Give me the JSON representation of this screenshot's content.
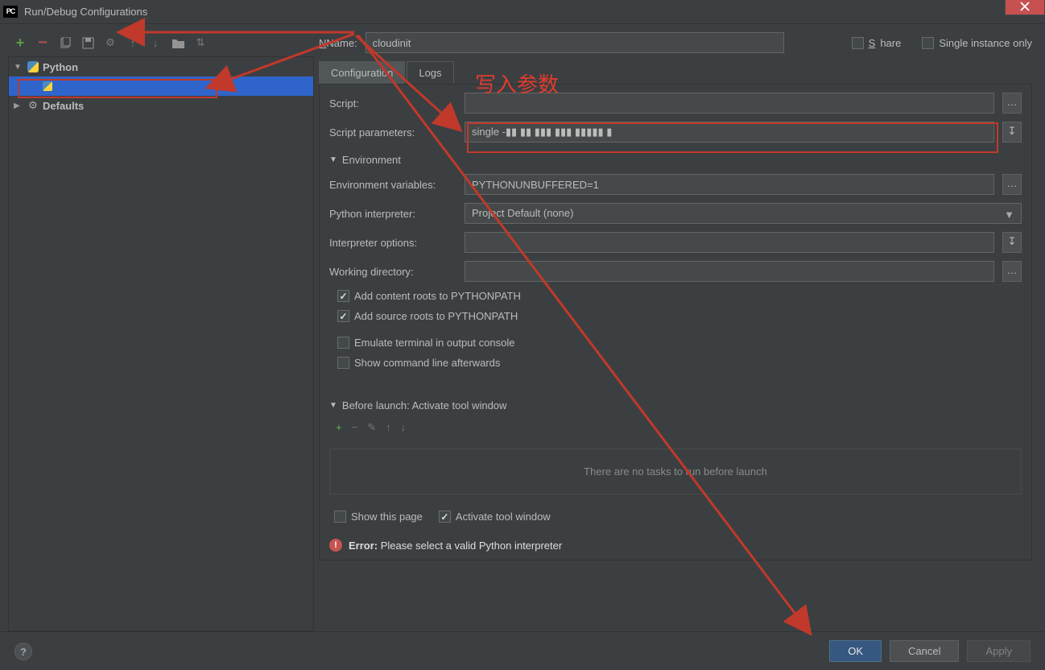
{
  "window": {
    "title": "Run/Debug Configurations"
  },
  "toolbar_icons": [
    "add",
    "remove",
    "copy",
    "save",
    "settings",
    "up",
    "down",
    "folder",
    "expand"
  ],
  "tree": {
    "python_label": "Python",
    "selected_item": "       ",
    "defaults_label": "Defaults"
  },
  "header": {
    "name_label": "Name:",
    "name_value": "cloudinit",
    "share_label": "Share",
    "single_instance_label": "Single instance only"
  },
  "tabs": {
    "configuration": "Configuration",
    "logs": "Logs"
  },
  "form": {
    "script_label": "Script:",
    "script_value": " ",
    "script_params_label": "Script parameters:",
    "script_params_value": "single -▮▮ ▮▮ ▮▮▮ ▮▮▮ ▮▮▮▮▮ ▮",
    "env_section": "Environment",
    "env_vars_label": "Environment variables:",
    "env_vars_value": "PYTHONUNBUFFERED=1",
    "interpreter_label": "Python interpreter:",
    "interpreter_value": "Project Default (none)",
    "interpreter_opts_label": "Interpreter options:",
    "interpreter_opts_value": "",
    "workdir_label": "Working directory:",
    "workdir_value": " ",
    "add_content_roots": "Add content roots to PYTHONPATH",
    "add_source_roots": "Add source roots to PYTHONPATH",
    "emulate_terminal": "Emulate terminal in output console",
    "show_cmdline": "Show command line afterwards",
    "before_launch_hdr": "Before launch: Activate tool window",
    "no_tasks": "There are no tasks to run before launch",
    "show_this_page": "Show this page",
    "activate_tool_window": "Activate tool window"
  },
  "error": {
    "label": "Error:",
    "msg": "Please select a valid Python interpreter"
  },
  "buttons": {
    "ok": "OK",
    "cancel": "Cancel",
    "apply": "Apply"
  },
  "annotation": "写入参数"
}
